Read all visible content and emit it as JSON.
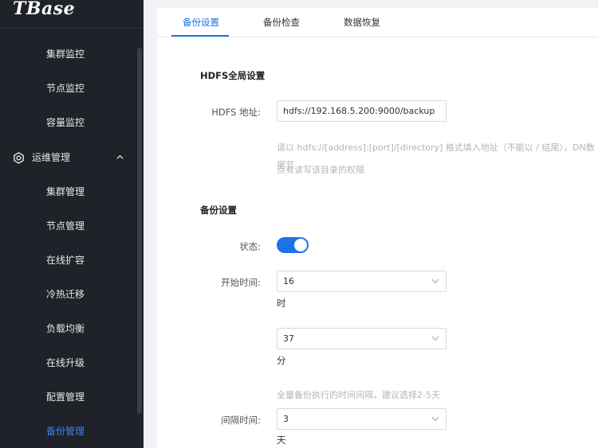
{
  "app": {
    "logo_text": "TBase"
  },
  "sidebar": {
    "items_top": [
      {
        "label": "集群监控"
      },
      {
        "label": "节点监控"
      },
      {
        "label": "容量监控"
      }
    ],
    "group": {
      "label": "运维管理",
      "icon": "gear-icon",
      "expanded": true
    },
    "items_group": [
      {
        "label": "集群管理"
      },
      {
        "label": "节点管理"
      },
      {
        "label": "在线扩容"
      },
      {
        "label": "冷热迁移"
      },
      {
        "label": "负载均衡"
      },
      {
        "label": "在线升级"
      },
      {
        "label": "配置管理"
      },
      {
        "label": "备份管理",
        "active": true
      }
    ],
    "colors": {
      "background": "#1f2229",
      "active": "#3b82f6"
    }
  },
  "tabs": [
    {
      "label": "备份设置",
      "active": true
    },
    {
      "label": "备份检查"
    },
    {
      "label": "数据恢复"
    }
  ],
  "hdfs": {
    "section_title": "HDFS全局设置",
    "address_label": "HDFS 地址:",
    "address_value": "hdfs://192.168.5.200:9000/backup",
    "hint_line1": "请以 hdfs://[address]:[port]/[directory] 格式填入地址（不能以 / 结尾），DN数据节",
    "hint_line2": "点有读写该目录的权限"
  },
  "backup": {
    "section_title": "备份设置",
    "status_label": "状态:",
    "status_on": true,
    "start_time_label": "开始时间:",
    "hour_value": "16",
    "hour_unit": "时",
    "minute_value": "37",
    "minute_unit": "分",
    "interval_hint": "全量备份执行的时间间隔，建议选择2-5天",
    "interval_label": "间隔时间:",
    "interval_value": "3",
    "interval_unit": "天"
  },
  "colors": {
    "accent": "#1a73e8"
  }
}
